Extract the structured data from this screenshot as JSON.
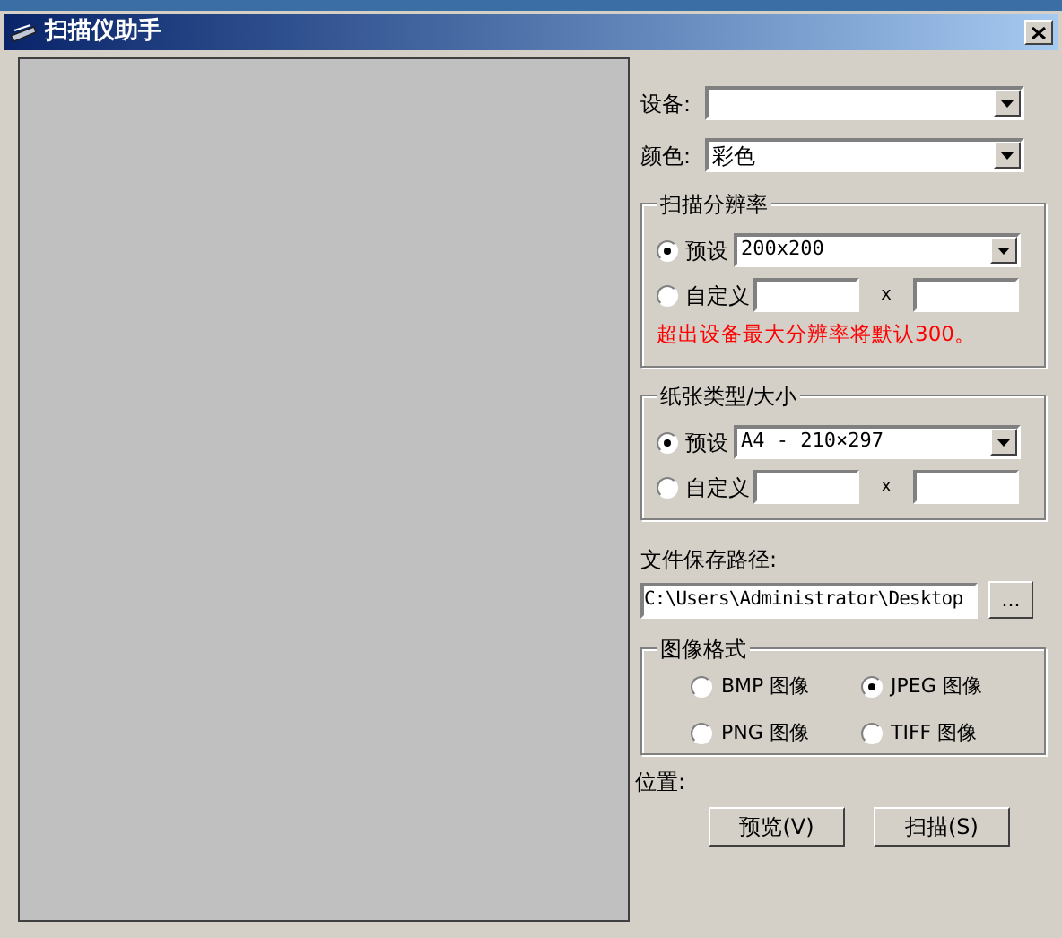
{
  "window": {
    "title": "扫描仪助手"
  },
  "device": {
    "label": "设备:"
  },
  "color": {
    "label": "颜色:",
    "value": "彩色"
  },
  "resolution": {
    "title": "扫描分辨率",
    "options": [
      {
        "kind": "preset",
        "label": "预设",
        "selected": true,
        "value": "200x200"
      },
      {
        "kind": "custom",
        "label": "自定义",
        "selected": false,
        "separator": "x"
      }
    ],
    "note": "超出设备最大分辨率将默认300。"
  },
  "paper": {
    "title": "纸张类型/大小",
    "options": [
      {
        "kind": "preset",
        "label": "预设",
        "selected": true,
        "value": "A4 - 210×297"
      },
      {
        "kind": "custom",
        "label": "自定义",
        "selected": false,
        "separator": "x"
      }
    ]
  },
  "save_path": {
    "label": "文件保存路径:",
    "value": "C:\\Users\\Administrator\\Desktop",
    "browse": "..."
  },
  "image_format": {
    "title": "图像格式",
    "options": [
      {
        "label": "BMP 图像",
        "selected": false
      },
      {
        "label": "JPEG 图像",
        "selected": true
      },
      {
        "label": "PNG 图像",
        "selected": false
      },
      {
        "label": "TIFF 图像",
        "selected": false
      }
    ]
  },
  "position": {
    "label": "位置:"
  },
  "buttons": [
    {
      "label": "预览(V)"
    },
    {
      "label": "扫描(S)"
    }
  ]
}
